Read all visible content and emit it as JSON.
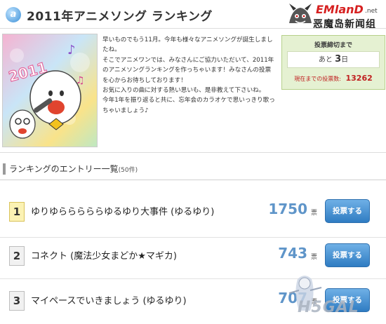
{
  "header": {
    "logo_glyph": "a",
    "title": "2011年アニメソング ランキング"
  },
  "watermark_top": {
    "brand": "EMlanD",
    "domain": ".net",
    "site_name": "恶魔岛新闻组"
  },
  "intro": {
    "paragraphs": [
      "早いものでもう11月。今年も様々なアニメソングが誕生しましたね。",
      "そこでアニメワンでは、みなさんにご協力いただいて、2011年のアニメソングランキングを作っちゃいます！みなさんの投票を心からお待ちしております！",
      "お気に入りの曲に対する熱い思いも、是非教えて下さいね。",
      "今年1年を振り返ると共に、忘年会のカラオケで思いっきり歌っちゃいましょう♪"
    ],
    "illustration_text": "2011"
  },
  "vote_box": {
    "heading": "投票締切まで",
    "prefix": "あと",
    "days": "3",
    "days_unit": "日",
    "current_label": "現在までの投票数:",
    "current_count": "13262",
    "bg_color": "#e5f1d2"
  },
  "section": {
    "title": "ランキングのエントリー一覧",
    "count": "(50件)"
  },
  "ranking": [
    {
      "rank": "1",
      "title": "ゆりゆらららららゆるゆり大事件 (ゆるゆり)",
      "votes": "1750",
      "unit": "票",
      "button": "投票する"
    },
    {
      "rank": "2",
      "title": "コネクト (魔法少女まどか★マギカ)",
      "votes": "743",
      "unit": "票",
      "button": "投票する"
    },
    {
      "rank": "3",
      "title": "マイペースでいきましょう (ゆるゆり)",
      "votes": "707",
      "unit": "票",
      "button": "投票する"
    }
  ],
  "watermark_bottom": {
    "text": "H5GAL"
  },
  "colors": {
    "accent_blue": "#5f95c9",
    "button_blue": "#2f7cc2",
    "count_red": "#c02020"
  }
}
